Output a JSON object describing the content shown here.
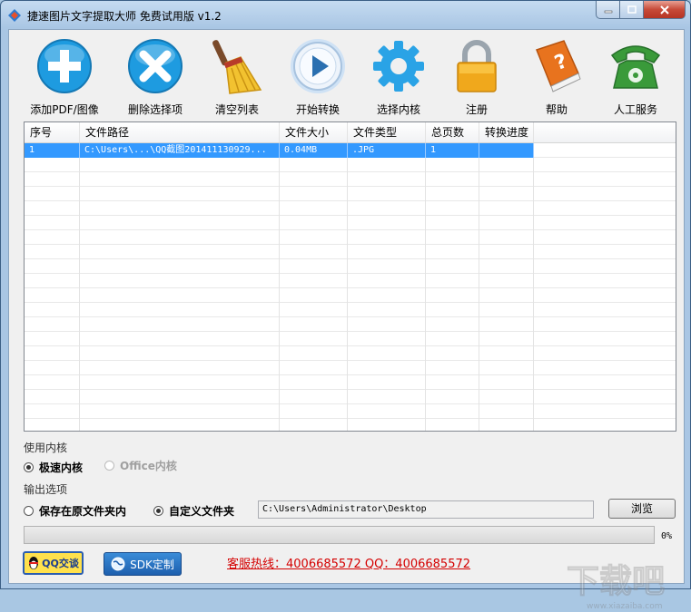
{
  "window": {
    "title": "捷速图片文字提取大师 免费试用版 v1.2"
  },
  "toolbar": {
    "buttons": [
      {
        "label": "添加PDF/图像",
        "icon": "add-plus-icon",
        "color": "#1e9be0"
      },
      {
        "label": "删除选择项",
        "icon": "delete-x-icon",
        "color": "#1e9be0"
      },
      {
        "label": "清空列表",
        "icon": "broom-icon",
        "color": "#f2c230"
      },
      {
        "label": "开始转换",
        "icon": "play-icon",
        "color": "#2a6fb0"
      },
      {
        "label": "选择内核",
        "icon": "gear-icon",
        "color": "#2aa3e6"
      },
      {
        "label": "注册",
        "icon": "lock-icon",
        "color": "#f0a81c"
      },
      {
        "label": "帮助",
        "icon": "help-book-icon",
        "color": "#e8731e"
      },
      {
        "label": "人工服务",
        "icon": "phone-icon",
        "color": "#3a9a3a"
      }
    ]
  },
  "file_list": {
    "columns": [
      "序号",
      "文件路径",
      "文件大小",
      "文件类型",
      "总页数",
      "转换进度"
    ],
    "rows": [
      [
        "1",
        "C:\\Users\\...\\QQ截图201411130929...",
        "0.04MB",
        ".JPG",
        "1",
        ""
      ]
    ]
  },
  "engine": {
    "section_label": "使用内核",
    "options": [
      {
        "label": "极速内核",
        "selected": true,
        "enabled": true
      },
      {
        "label": "Office内核",
        "selected": false,
        "enabled": false
      }
    ]
  },
  "output": {
    "section_label": "输出选项",
    "options": [
      {
        "label": "保存在原文件夹内",
        "selected": false
      },
      {
        "label": "自定义文件夹",
        "selected": true
      }
    ],
    "folder_path": "C:\\Users\\Administrator\\Desktop",
    "browse_label": "浏览"
  },
  "progress": {
    "value": 0,
    "label": "0%"
  },
  "footer": {
    "qq_button_label": "QQ交谈",
    "sdk_button_label": "SDK定制",
    "hotline": "客服热线：4006685572 QQ：4006685572"
  },
  "watermark": {
    "text": "下载吧",
    "url": "www.xiazaiba.com"
  },
  "colors": {
    "selection": "#3399ff",
    "hotline": "#d40000",
    "frame": "#a9c6e4"
  }
}
